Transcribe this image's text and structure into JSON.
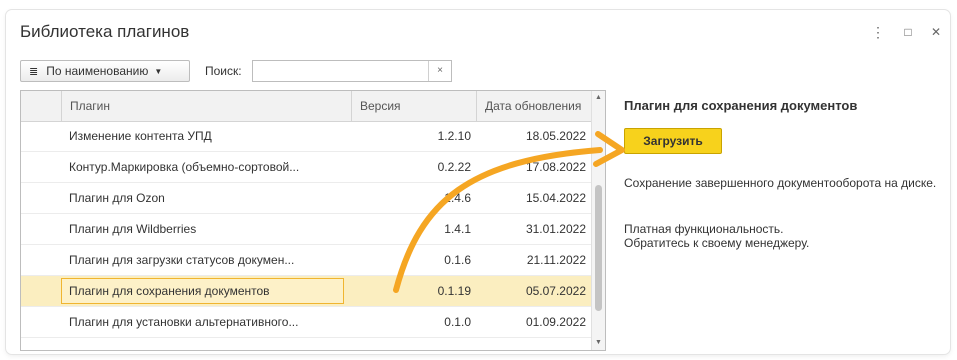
{
  "window": {
    "title": "Библиотека плагинов",
    "menu_icon": "⋮",
    "maximize_icon": "□",
    "close_icon": "✕"
  },
  "toolbar": {
    "sort_label": "По наименованию",
    "search_label": "Поиск:",
    "search_value": "",
    "clear_icon": "×"
  },
  "table": {
    "columns": [
      "Плагин",
      "Версия",
      "Дата обновления"
    ],
    "rows": [
      {
        "name": "Изменение контента УПД",
        "version": "1.2.10",
        "date": "18.05.2022"
      },
      {
        "name": "Контур.Маркировка (объемно-сортовой...",
        "version": "0.2.22",
        "date": "17.08.2022"
      },
      {
        "name": "Плагин для Ozon",
        "version": "1.4.6",
        "date": "15.04.2022"
      },
      {
        "name": "Плагин для Wildberries",
        "version": "1.4.1",
        "date": "31.01.2022"
      },
      {
        "name": "Плагин для загрузки статусов докумен...",
        "version": "0.1.6",
        "date": "21.11.2022"
      },
      {
        "name": "Плагин для сохранения документов",
        "version": "0.1.19",
        "date": "05.07.2022"
      },
      {
        "name": "Плагин для установки альтернативного...",
        "version": "0.1.0",
        "date": "01.09.2022"
      }
    ],
    "selected_row": 5
  },
  "details": {
    "title": "Плагин для сохранения документов",
    "load_button": "Загрузить",
    "description": "Сохранение завершенного документооборота на диске.",
    "paid_line1": "Платная функциональность.",
    "paid_line2": "Обратитесь к своему менеджеру."
  },
  "colors": {
    "accent_arrow": "#f5a623",
    "load_button": "#f7d21c",
    "selected_row": "#fbeec0"
  }
}
